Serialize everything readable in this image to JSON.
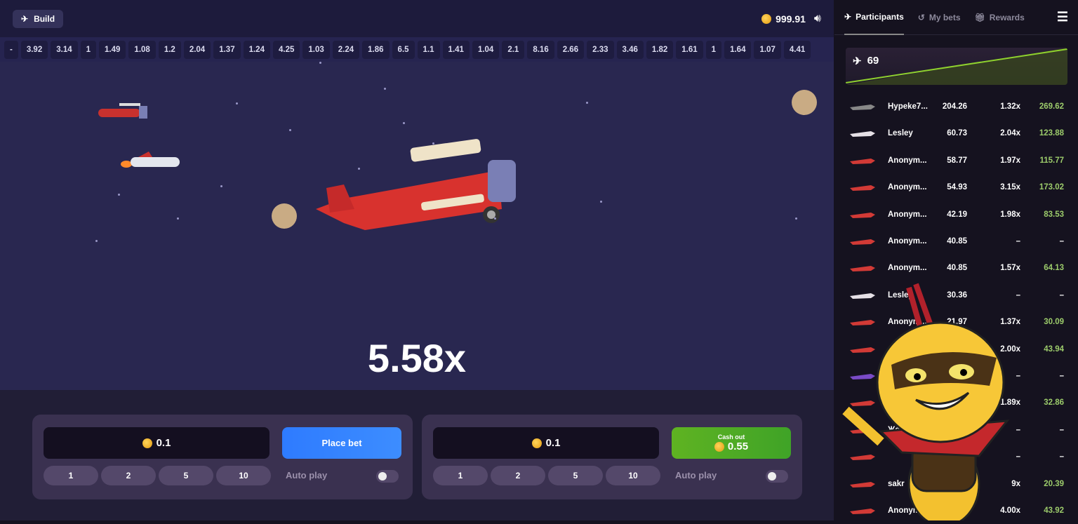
{
  "header": {
    "build_label": "Build",
    "balance": "999.91",
    "icons": {
      "plane": "plane-icon",
      "coin": "coin-icon",
      "sound": "speaker-icon"
    }
  },
  "history": [
    "-",
    "3.92",
    "3.14",
    "1",
    "1.49",
    "1.08",
    "1.2",
    "2.04",
    "1.37",
    "1.24",
    "4.25",
    "1.03",
    "2.24",
    "1.86",
    "6.5",
    "1.1",
    "1.41",
    "1.04",
    "2.1",
    "8.16",
    "2.66",
    "2.33",
    "3.46",
    "1.82",
    "1.61",
    "1",
    "1.64",
    "1.07",
    "4.41"
  ],
  "game": {
    "multiplier": "5.58x"
  },
  "bet_panels": [
    {
      "amount": "0.1",
      "chips": [
        "1",
        "2",
        "5",
        "10"
      ],
      "action": "Place bet",
      "auto_play": "Auto play",
      "auto_on": false
    },
    {
      "amount": "0.1",
      "chips": [
        "1",
        "2",
        "5",
        "10"
      ],
      "action_label": "Cash out",
      "action_value": "0.55",
      "auto_play": "Auto play",
      "auto_on": false
    }
  ],
  "sidebar": {
    "tabs": [
      {
        "label": "Participants",
        "icon": "plane-takeoff-icon",
        "active": true
      },
      {
        "label": "My bets",
        "icon": "history-icon"
      },
      {
        "label": "Rewards",
        "icon": "gift-icon"
      }
    ],
    "participants_count": "69",
    "colors": {
      "win": "#9ccb6b",
      "graph": "#8fd12e"
    },
    "rows": [
      {
        "plane": "jet",
        "name": "Hypeke7...",
        "bet": "204.26",
        "mult": "1.32x",
        "win": "269.62"
      },
      {
        "plane": "white",
        "name": "Lesley",
        "bet": "60.73",
        "mult": "2.04x",
        "win": "123.88"
      },
      {
        "plane": "red",
        "name": "Anonym...",
        "bet": "58.77",
        "mult": "1.97x",
        "win": "115.77"
      },
      {
        "plane": "red",
        "name": "Anonym...",
        "bet": "54.93",
        "mult": "3.15x",
        "win": "173.02"
      },
      {
        "plane": "red",
        "name": "Anonym...",
        "bet": "42.19",
        "mult": "1.98x",
        "win": "83.53"
      },
      {
        "plane": "red",
        "name": "Anonym...",
        "bet": "40.85",
        "mult": "–",
        "win": "–"
      },
      {
        "plane": "red",
        "name": "Anonym...",
        "bet": "40.85",
        "mult": "1.57x",
        "win": "64.13"
      },
      {
        "plane": "white",
        "name": "Lesley",
        "bet": "30.36",
        "mult": "–",
        "win": "–"
      },
      {
        "plane": "red",
        "name": "Anonym...",
        "bet": "21.97",
        "mult": "1.37x",
        "win": "30.09"
      },
      {
        "plane": "red",
        "name": "Anon",
        "bet": "",
        "mult": "2.00x",
        "win": "43.94"
      },
      {
        "plane": "purple",
        "name": "",
        "bet": "",
        "mult": "–",
        "win": "–"
      },
      {
        "plane": "red",
        "name": "",
        "bet": "",
        "mult": "1.89x",
        "win": "32.86"
      },
      {
        "plane": "red",
        "name": "Жо",
        "bet": "",
        "mult": "–",
        "win": "–"
      },
      {
        "plane": "red",
        "name": "",
        "bet": "",
        "mult": "–",
        "win": "–"
      },
      {
        "plane": "red",
        "name": "sakr",
        "bet": "",
        "mult": "9x",
        "win": "20.39"
      },
      {
        "plane": "red",
        "name": "Anonym",
        "bet": "",
        "mult": "4.00x",
        "win": "43.92"
      }
    ]
  }
}
